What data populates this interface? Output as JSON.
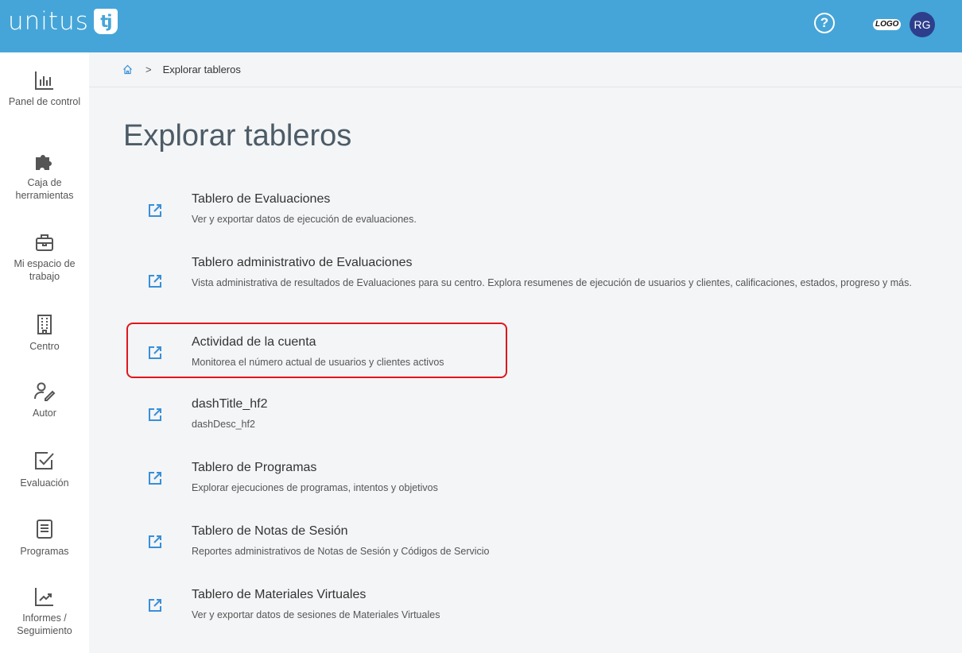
{
  "header": {
    "logo_text": "unitus",
    "logo_mark": "tj",
    "help_icon": "help-circle-icon",
    "help_glyph": "?",
    "brand_logo": "LOGO",
    "avatar_initials": "RG",
    "colors": {
      "bar": "#45a5d8",
      "avatar": "#2d3f8c"
    }
  },
  "sidebar": {
    "items": [
      {
        "label": "Panel de control",
        "icon": "bar-chart-icon"
      },
      {
        "label": "Caja de herramientas",
        "icon": "puzzle-icon"
      },
      {
        "label": "Mi espacio de trabajo",
        "icon": "briefcase-icon"
      },
      {
        "label": "Centro",
        "icon": "building-icon"
      },
      {
        "label": "Autor",
        "icon": "user-pen-icon"
      },
      {
        "label": "Evaluación",
        "icon": "checkbox-icon"
      },
      {
        "label": "Programas",
        "icon": "document-icon"
      },
      {
        "label": "Informes / Seguimiento",
        "icon": "trend-chart-icon"
      }
    ]
  },
  "breadcrumb": {
    "home_icon": "home-icon",
    "separator": ">",
    "current": "Explorar tableros"
  },
  "page": {
    "title": "Explorar tableros"
  },
  "dashboards": [
    {
      "title": "Tablero de Evaluaciones",
      "description": "Ver y exportar datos de ejecución de evaluaciones."
    },
    {
      "title": "Tablero administrativo de Evaluaciones",
      "description": "Vista administrativa de resultados de Evaluaciones para su centro. Explora resumenes de ejecución de usuarios y clientes, calificaciones, estados, progreso y más."
    },
    {
      "title": "Actividad de la cuenta",
      "description": "Monitorea el número actual de usuarios y clientes activos",
      "highlighted": true
    },
    {
      "title": "dashTitle_hf2",
      "description": "dashDesc_hf2"
    },
    {
      "title": "Tablero de Programas",
      "description": "Explorar ejecuciones de programas, intentos y objetivos"
    },
    {
      "title": "Tablero de Notas de Sesión",
      "description": "Reportes administrativos de Notas de Sesión y Códigos de Servicio"
    },
    {
      "title": "Tablero de Materiales Virtuales",
      "description": "Ver y exportar datos de sesiones de Materiales Virtuales"
    }
  ],
  "dashboard_icon": "external-link-icon",
  "colors": {
    "link_icon": "#3a8fd6",
    "highlight": "#e0161c"
  }
}
